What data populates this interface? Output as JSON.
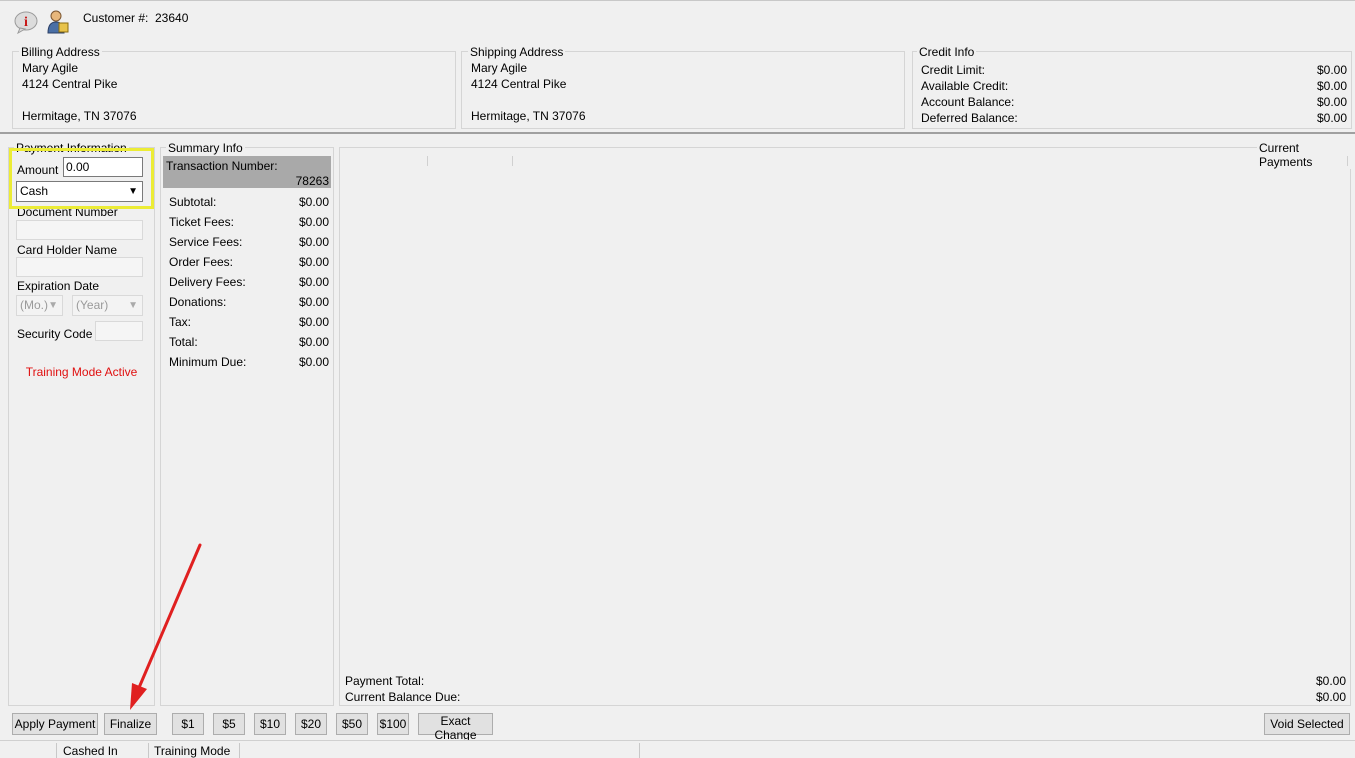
{
  "header": {
    "customer_label": "Customer #:",
    "customer_number": "23640"
  },
  "billing": {
    "legend": "Billing Address",
    "name": "Mary Agile",
    "street": "4124 Central Pike",
    "city": "Hermitage, TN 37076"
  },
  "shipping": {
    "legend": "Shipping Address",
    "name": "Mary Agile",
    "street": "4124 Central Pike",
    "city": "Hermitage, TN 37076"
  },
  "credit": {
    "legend": "Credit Info",
    "rows": [
      {
        "label": "Credit Limit:",
        "value": "$0.00"
      },
      {
        "label": "Available Credit:",
        "value": "$0.00"
      },
      {
        "label": "Account Balance:",
        "value": "$0.00"
      },
      {
        "label": "Deferred Balance:",
        "value": "$0.00"
      }
    ]
  },
  "payment": {
    "legend": "Payment Information",
    "amount_label": "Amount",
    "amount_value": "0.00",
    "method_selected": "Cash",
    "document_number_label": "Document Number",
    "card_holder_label": "Card Holder Name",
    "expiration_label": "Expiration Date",
    "month_placeholder": "(Mo.)",
    "year_placeholder": "(Year)",
    "security_code_label": "Security Code",
    "training_mode_text": "Training Mode Active"
  },
  "summary": {
    "legend": "Summary Info",
    "transaction_label": "Transaction Number:",
    "transaction_number": "78263",
    "rows": [
      {
        "label": "Subtotal:",
        "value": "$0.00"
      },
      {
        "label": "Ticket Fees:",
        "value": "$0.00"
      },
      {
        "label": "Service Fees:",
        "value": "$0.00"
      },
      {
        "label": "Order Fees:",
        "value": "$0.00"
      },
      {
        "label": "Delivery Fees:",
        "value": "$0.00"
      },
      {
        "label": "Donations:",
        "value": "$0.00"
      },
      {
        "label": "Tax:",
        "value": "$0.00"
      },
      {
        "label": "Total:",
        "value": "$0.00"
      },
      {
        "label": "Minimum Due:",
        "value": "$0.00"
      }
    ]
  },
  "payments": {
    "legend": "Current Payments",
    "payment_total_label": "Payment Total:",
    "payment_total_value": "$0.00",
    "balance_due_label": "Current Balance Due:",
    "balance_due_value": "$0.00"
  },
  "buttons": {
    "apply_payment": "Apply Payment",
    "finalize": "Finalize",
    "one": "$1",
    "five": "$5",
    "ten": "$10",
    "twenty": "$20",
    "fifty": "$50",
    "hundred": "$100",
    "exact_change": "Exact Change",
    "void_selected": "Void Selected"
  },
  "status_bar": {
    "cashed_in": "Cashed In",
    "training_mode": "Training Mode"
  },
  "colors": {
    "highlight": "#ecec35",
    "arrow": "#e02020",
    "training_text": "#e01010",
    "transaction_bg": "#a9a9a9"
  }
}
